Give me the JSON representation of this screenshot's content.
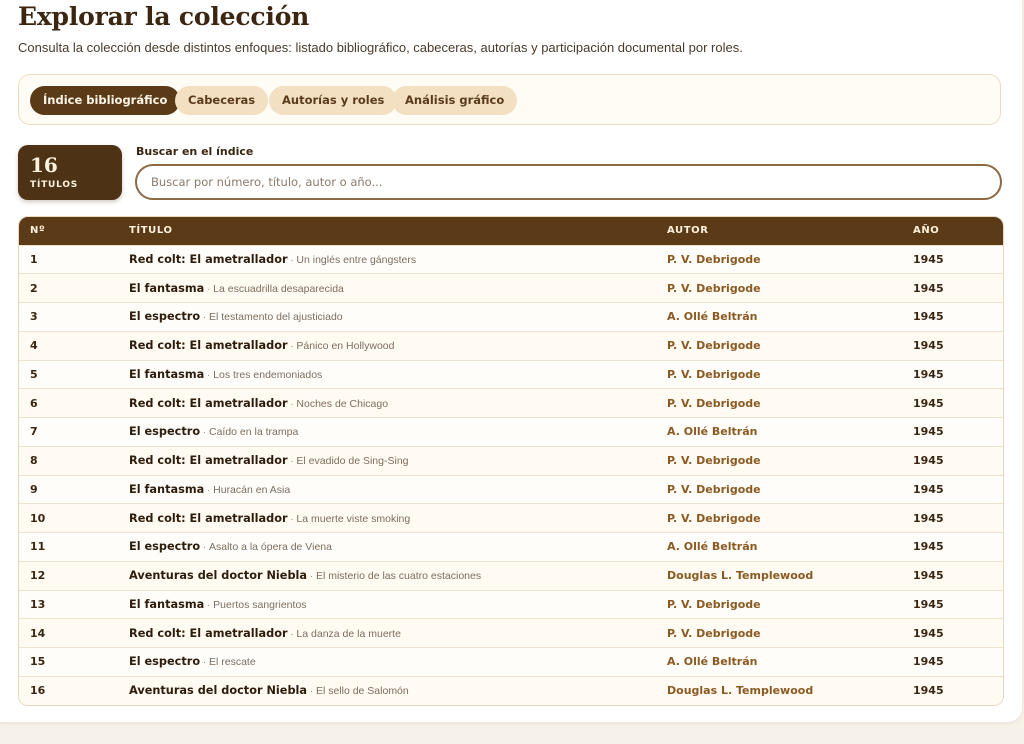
{
  "page": {
    "title": "Explorar la colección",
    "subtitle": "Consulta la colección desde distintos enfoques: listado bibliográfico, cabeceras, autorías y participación documental por roles."
  },
  "tabs": [
    {
      "label": "Índice bibliográfico",
      "active": true
    },
    {
      "label": "Cabeceras",
      "active": false
    },
    {
      "label": "Autorías y roles",
      "active": false
    },
    {
      "label": "Análisis gráfico",
      "active": false
    }
  ],
  "counter": {
    "value": "16",
    "label": "TÍTULOS"
  },
  "search": {
    "label": "Buscar en el índice",
    "placeholder": "Buscar por número, título, autor o año...",
    "value": ""
  },
  "table": {
    "headers": [
      "Nº",
      "TÍTULO",
      "AUTOR",
      "AÑO"
    ],
    "rows": [
      {
        "n": "1",
        "title": "Red colt: El ametrallador",
        "subtitle": "Un inglés entre gángsters",
        "author": "P. V. Debrigode",
        "year": "1945"
      },
      {
        "n": "2",
        "title": "El fantasma",
        "subtitle": "La escuadrilla desaparecida",
        "author": "P. V. Debrigode",
        "year": "1945"
      },
      {
        "n": "3",
        "title": "El espectro",
        "subtitle": "El testamento del ajusticiado",
        "author": "A. Ollé Beltrán",
        "year": "1945"
      },
      {
        "n": "4",
        "title": "Red colt: El ametrallador",
        "subtitle": "Pánico en Hollywood",
        "author": "P. V. Debrigode",
        "year": "1945"
      },
      {
        "n": "5",
        "title": "El fantasma",
        "subtitle": "Los tres endemoniados",
        "author": "P. V. Debrigode",
        "year": "1945"
      },
      {
        "n": "6",
        "title": "Red colt: El ametrallador",
        "subtitle": "Noches de Chicago",
        "author": "P. V. Debrigode",
        "year": "1945"
      },
      {
        "n": "7",
        "title": "El espectro",
        "subtitle": "Caído en la trampa",
        "author": "A. Ollé Beltrán",
        "year": "1945"
      },
      {
        "n": "8",
        "title": "Red colt: El ametrallador",
        "subtitle": "El evadido de Sing-Sing",
        "author": "P. V. Debrigode",
        "year": "1945"
      },
      {
        "n": "9",
        "title": "El fantasma",
        "subtitle": "Huracán en Asia",
        "author": "P. V. Debrigode",
        "year": "1945"
      },
      {
        "n": "10",
        "title": "Red colt: El ametrallador",
        "subtitle": "La muerte viste smoking",
        "author": "P. V. Debrigode",
        "year": "1945"
      },
      {
        "n": "11",
        "title": "El espectro",
        "subtitle": "Asalto a la ópera de Viena",
        "author": "A. Ollé Beltrán",
        "year": "1945"
      },
      {
        "n": "12",
        "title": "Aventuras del doctor Niebla",
        "subtitle": "El misterio de las cuatro estaciones",
        "author": "Douglas L. Templewood",
        "year": "1945"
      },
      {
        "n": "13",
        "title": "El fantasma",
        "subtitle": "Puertos sangrientos",
        "author": "P. V. Debrigode",
        "year": "1945"
      },
      {
        "n": "14",
        "title": "Red colt: El ametrallador",
        "subtitle": "La danza de la muerte",
        "author": "P. V. Debrigode",
        "year": "1945"
      },
      {
        "n": "15",
        "title": "El espectro",
        "subtitle": "El rescate",
        "author": "A. Ollé Beltrán",
        "year": "1945"
      },
      {
        "n": "16",
        "title": "Aventuras del doctor Niebla",
        "subtitle": "El sello de Salomón",
        "author": "Douglas L. Templewood",
        "year": "1945"
      }
    ]
  },
  "colors": {
    "accent": "#5b3a17",
    "author": "#8a5a22",
    "tab_bg": "#f3dfc1"
  }
}
